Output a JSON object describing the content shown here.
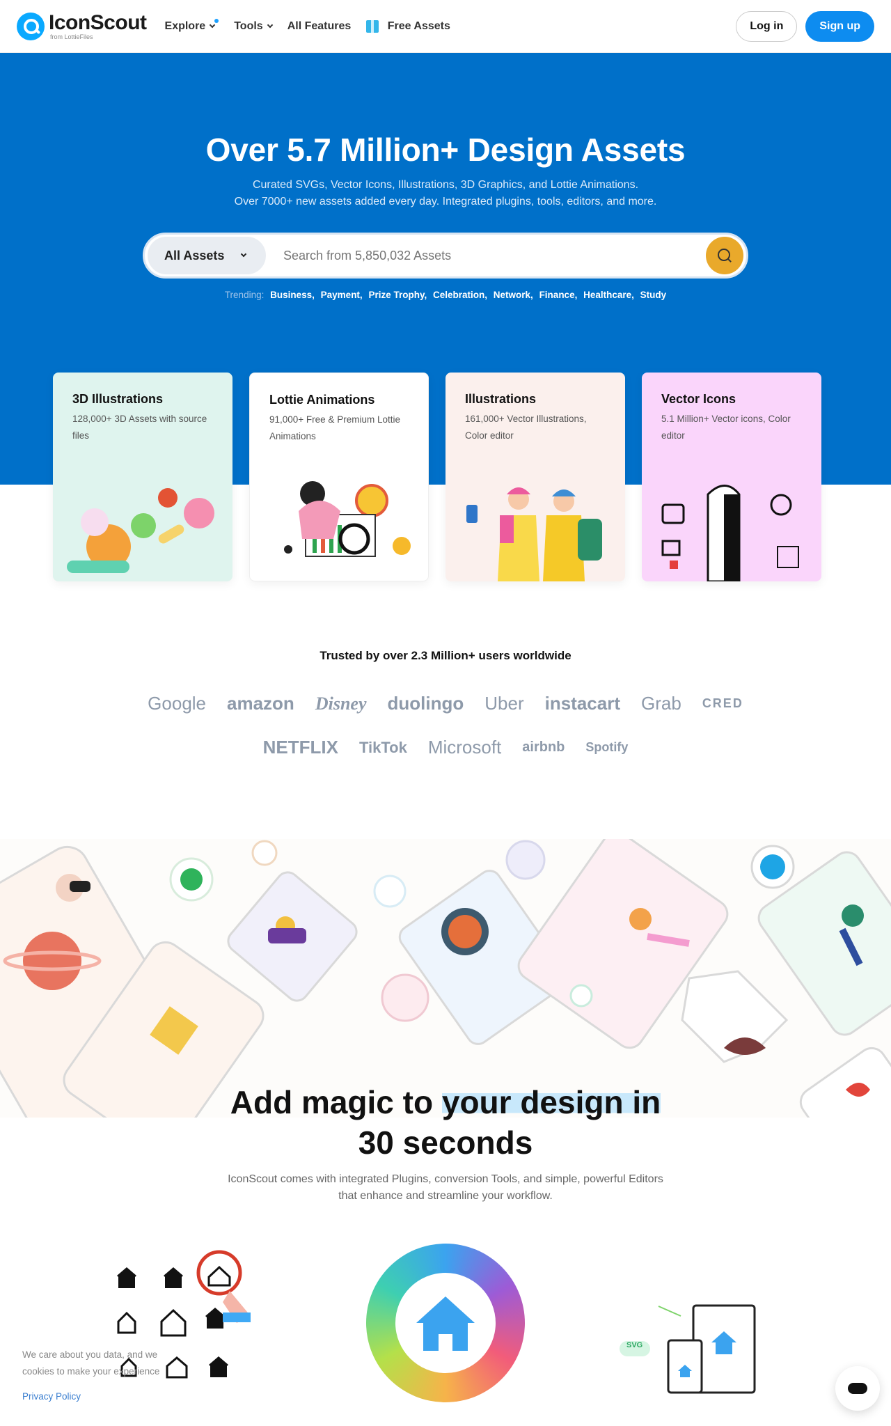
{
  "nav": {
    "logo_name": "IconScout",
    "logo_sub": "from LottieFiles",
    "explore": "Explore",
    "tools": "Tools",
    "all_features": "All Features",
    "free_assets": "Free Assets",
    "login": "Log in",
    "signup": "Sign up"
  },
  "hero": {
    "title": "Over 5.7 Million+ Design Assets",
    "sub_line1": "Curated SVGs, Vector Icons, Illustrations, 3D Graphics, and Lottie Animations.",
    "sub_line2": "Over 7000+ new assets added every day. Integrated plugins, tools, editors, and more.",
    "search_type": "All Assets",
    "search_placeholder": "Search from 5,850,032 Assets",
    "trending_label": "Trending:",
    "trending": [
      "Business,",
      "Payment,",
      "Prize Trophy,",
      "Celebration,",
      "Network,",
      "Finance,",
      "Healthcare,",
      "Study"
    ]
  },
  "cards": [
    {
      "title": "3D Illustrations",
      "desc": "128,000+ 3D Assets with source files"
    },
    {
      "title": "Lottie Animations",
      "desc": "91,000+ Free & Premium Lottie Animations"
    },
    {
      "title": "Illustrations",
      "desc": "161,000+ Vector Illustrations, Color editor"
    },
    {
      "title": "Vector Icons",
      "desc": "5.1 Million+ Vector icons, Color editor"
    }
  ],
  "trust": {
    "title": "Trusted by over 2.3 Million+ users worldwide",
    "row1": [
      "Google",
      "amazon",
      "Disney",
      "duolingo",
      "Uber",
      "instacart",
      "Grab",
      "CRED"
    ],
    "row2": [
      "NETFLIX",
      "TikTok",
      "Microsoft",
      "airbnb",
      "Spotify"
    ]
  },
  "magic": {
    "title_a": "Add magic to ",
    "title_hl": "your design in",
    "title_b": "30 seconds",
    "sub_line1": "IconScout comes with integrated Plugins, conversion Tools, and simple, powerful Editors",
    "sub_line2": "that enhance and streamline your workflow."
  },
  "cookie": {
    "text": "We care about you data, and we cookies to make your experience",
    "link": "Privacy Policy"
  },
  "svg_badge": "SVG",
  "colors": {
    "primary": "#0070c9",
    "accent": "#e9a92b",
    "signup": "#0d8cf0"
  }
}
